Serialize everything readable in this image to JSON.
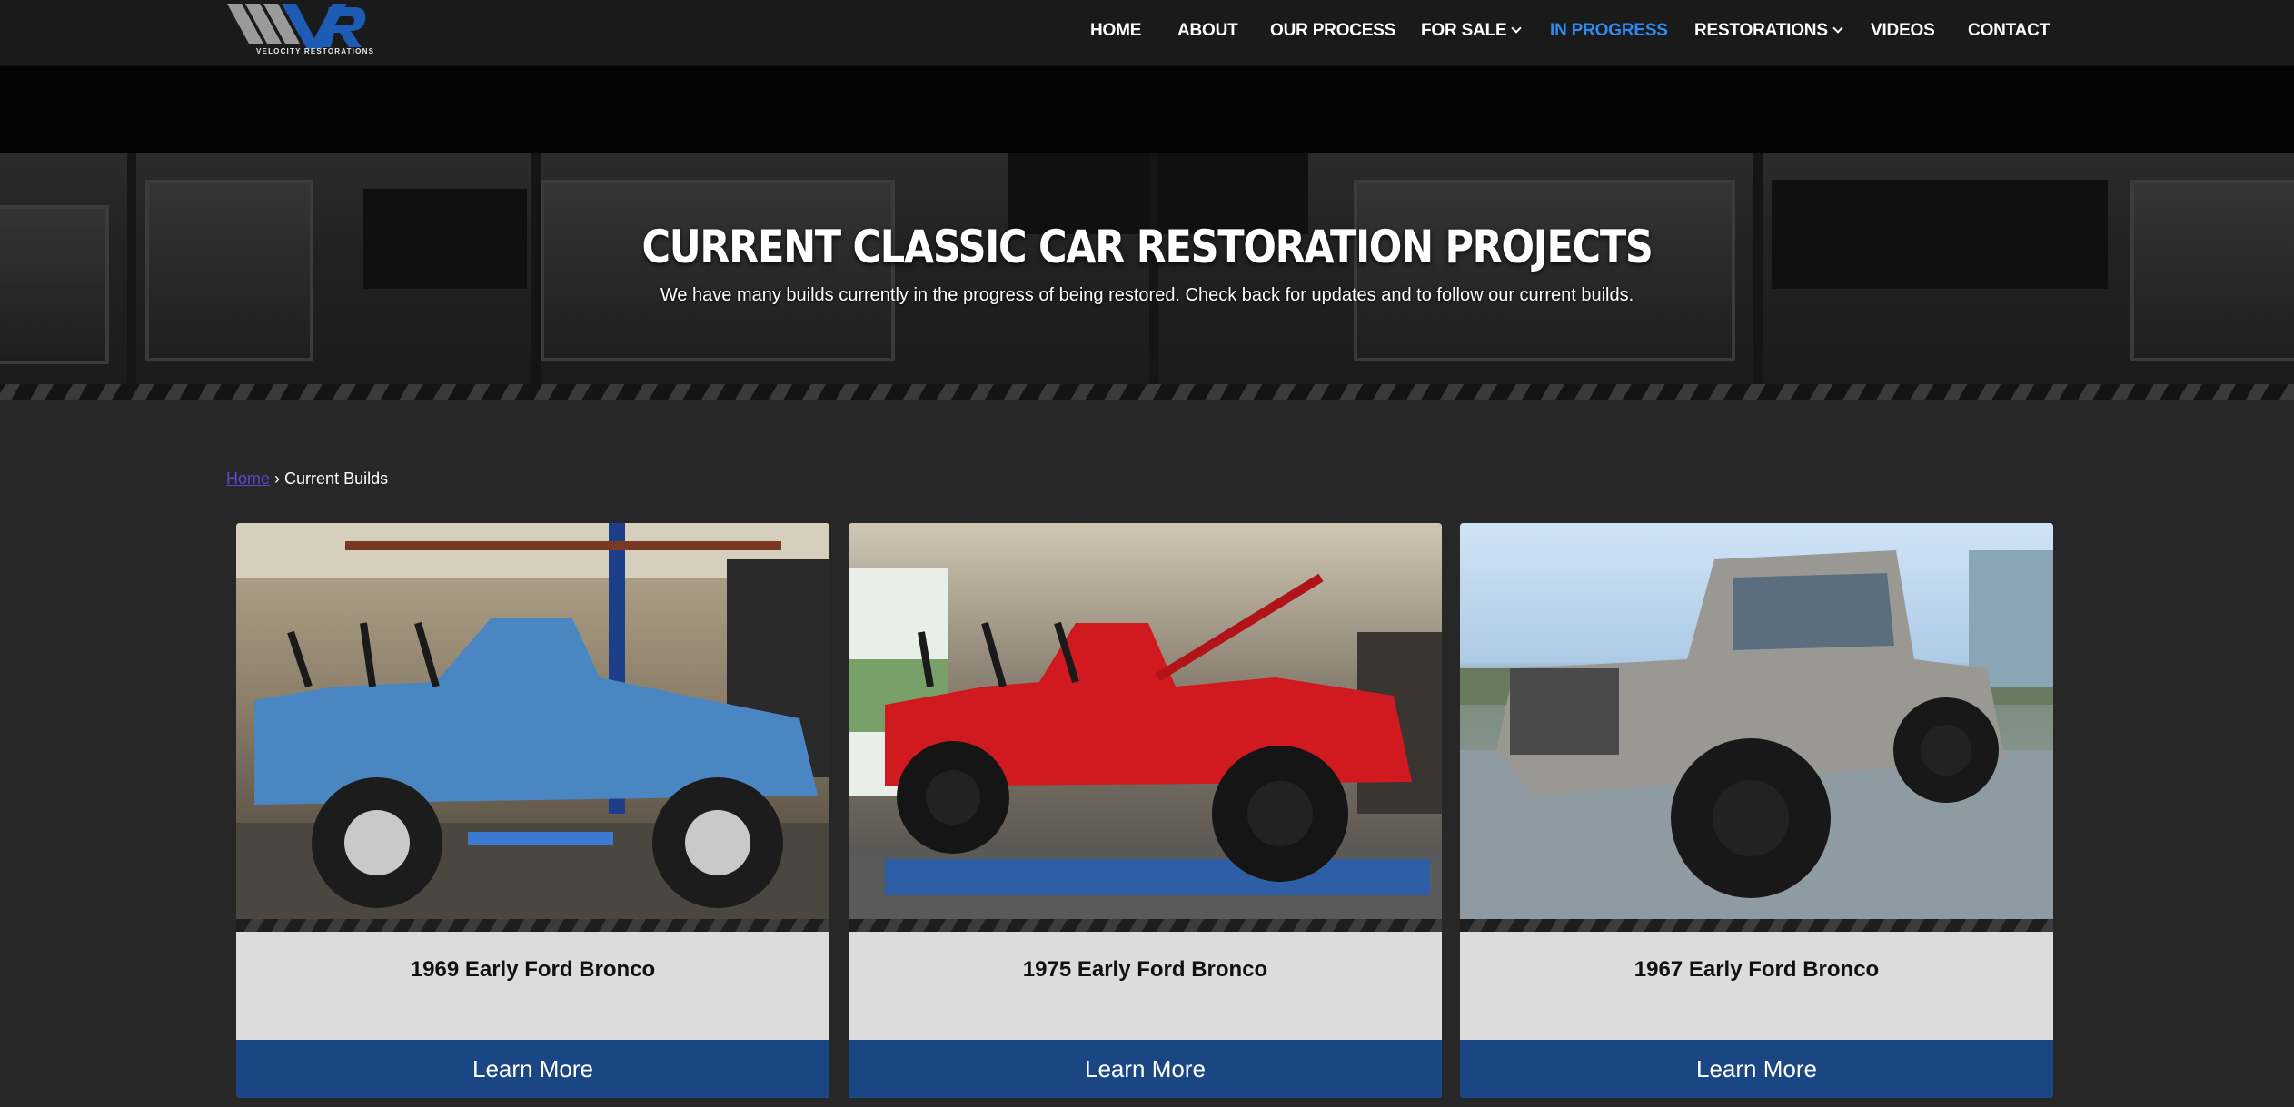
{
  "header": {
    "logo_text": "VELOCITY RESTORATIONS",
    "nav": [
      {
        "label": "HOME"
      },
      {
        "label": "ABOUT"
      },
      {
        "label": "OUR PROCESS"
      },
      {
        "label": "FOR SALE"
      },
      {
        "label": "IN PROGRESS"
      },
      {
        "label": "RESTORATIONS"
      },
      {
        "label": "VIDEOS"
      },
      {
        "label": "CONTACT"
      }
    ],
    "active_item": "IN PROGRESS",
    "active_color": "#2a8cf0"
  },
  "hero": {
    "title": "CURRENT CLASSIC CAR RESTORATION PROJECTS",
    "subtitle": "We have many builds currently in the progress of being restored. Check back for updates and to follow our current builds."
  },
  "breadcrumb": {
    "home": "Home",
    "separator": "›",
    "current": "Current Builds"
  },
  "cards": [
    {
      "title": "1969 Early Ford Bronco",
      "button": "Learn More",
      "vehicle_color": "#4a86c2"
    },
    {
      "title": "1975 Early Ford Bronco",
      "button": "Learn More",
      "vehicle_color": "#d01a20"
    },
    {
      "title": "1967 Early Ford Bronco",
      "button": "Learn More",
      "vehicle_color": "#9a9893"
    }
  ],
  "colors": {
    "button_bg": "#1b4684",
    "page_bg": "#272727",
    "card_bg": "#dcdcdc"
  }
}
